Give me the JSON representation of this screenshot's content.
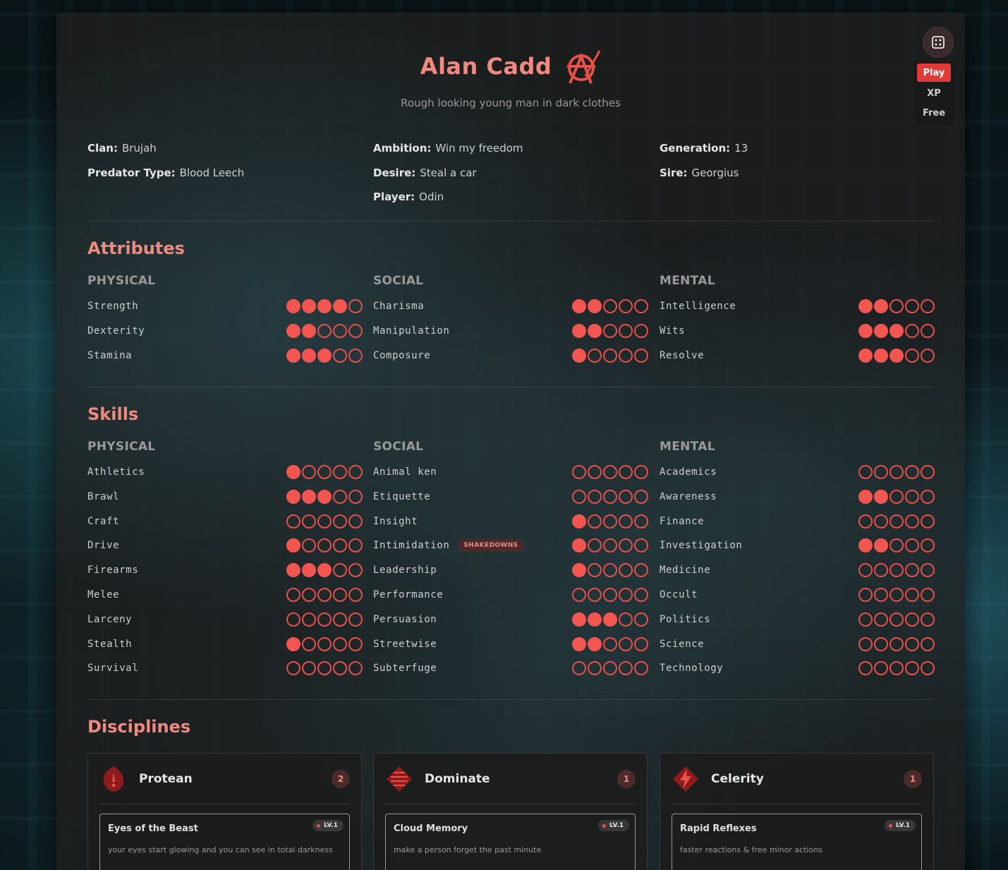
{
  "character": {
    "name": "Alan Cadd",
    "subtitle": "Rough looking young man in dark clothes",
    "clan_logo_icon": "brujah-anarch-icon"
  },
  "controls": {
    "dice_icon": "dice-icon",
    "modes": [
      "Play",
      "XP",
      "Free"
    ],
    "active_mode": "Play"
  },
  "info": {
    "col1": [
      {
        "label": "Clan:",
        "value": "Brujah"
      },
      {
        "label": "Predator Type:",
        "value": "Blood Leech"
      }
    ],
    "col2": [
      {
        "label": "Ambition:",
        "value": "Win my freedom"
      },
      {
        "label": "Desire:",
        "value": "Steal a car"
      },
      {
        "label": "Player:",
        "value": "Odin"
      }
    ],
    "col3": [
      {
        "label": "Generation:",
        "value": "13"
      },
      {
        "label": "Sire:",
        "value": "Georgius"
      }
    ]
  },
  "attributes": {
    "title": "Attributes",
    "max_dots": 5,
    "categories": [
      {
        "name": "PHYSICAL",
        "traits": [
          {
            "name": "Strength",
            "value": 4
          },
          {
            "name": "Dexterity",
            "value": 2
          },
          {
            "name": "Stamina",
            "value": 3
          }
        ]
      },
      {
        "name": "SOCIAL",
        "traits": [
          {
            "name": "Charisma",
            "value": 2
          },
          {
            "name": "Manipulation",
            "value": 2
          },
          {
            "name": "Composure",
            "value": 1
          }
        ]
      },
      {
        "name": "MENTAL",
        "traits": [
          {
            "name": "Intelligence",
            "value": 2
          },
          {
            "name": "Wits",
            "value": 3
          },
          {
            "name": "Resolve",
            "value": 3
          }
        ]
      }
    ]
  },
  "skills": {
    "title": "Skills",
    "max_dots": 5,
    "categories": [
      {
        "name": "PHYSICAL",
        "traits": [
          {
            "name": "Athletics",
            "value": 1
          },
          {
            "name": "Brawl",
            "value": 3
          },
          {
            "name": "Craft",
            "value": 0
          },
          {
            "name": "Drive",
            "value": 1
          },
          {
            "name": "Firearms",
            "value": 3
          },
          {
            "name": "Melee",
            "value": 0
          },
          {
            "name": "Larceny",
            "value": 0
          },
          {
            "name": "Stealth",
            "value": 1
          },
          {
            "name": "Survival",
            "value": 0
          }
        ]
      },
      {
        "name": "SOCIAL",
        "traits": [
          {
            "name": "Animal ken",
            "value": 0
          },
          {
            "name": "Etiquette",
            "value": 0
          },
          {
            "name": "Insight",
            "value": 1
          },
          {
            "name": "Intimidation",
            "value": 1,
            "specialty": "SHAKEDOWNS"
          },
          {
            "name": "Leadership",
            "value": 1
          },
          {
            "name": "Performance",
            "value": 0
          },
          {
            "name": "Persuasion",
            "value": 3
          },
          {
            "name": "Streetwise",
            "value": 2
          },
          {
            "name": "Subterfuge",
            "value": 0
          }
        ]
      },
      {
        "name": "MENTAL",
        "traits": [
          {
            "name": "Academics",
            "value": 0
          },
          {
            "name": "Awareness",
            "value": 2
          },
          {
            "name": "Finance",
            "value": 0
          },
          {
            "name": "Investigation",
            "value": 2
          },
          {
            "name": "Medicine",
            "value": 0
          },
          {
            "name": "Occult",
            "value": 0
          },
          {
            "name": "Politics",
            "value": 0
          },
          {
            "name": "Science",
            "value": 0
          },
          {
            "name": "Technology",
            "value": 0
          }
        ]
      }
    ]
  },
  "disciplines": {
    "title": "Disciplines",
    "items": [
      {
        "name": "Protean",
        "level": "2",
        "icon": "protean-icon",
        "power": {
          "name": "Eyes of the Beast",
          "level_label": "LV.1",
          "description": "your eyes start glowing and you can see in total darkness"
        }
      },
      {
        "name": "Dominate",
        "level": "1",
        "icon": "dominate-icon",
        "power": {
          "name": "Cloud Memory",
          "level_label": "LV.1",
          "description": "make a person forget the past minute"
        }
      },
      {
        "name": "Celerity",
        "level": "1",
        "icon": "celerity-icon",
        "power": {
          "name": "Rapid Reflexes",
          "level_label": "LV.1",
          "description": "faster reactions & free minor actions"
        }
      }
    ]
  },
  "colors": {
    "accent": "#f08a80",
    "dot": "#f35550",
    "sheet_bg": "#1e1e1e"
  }
}
